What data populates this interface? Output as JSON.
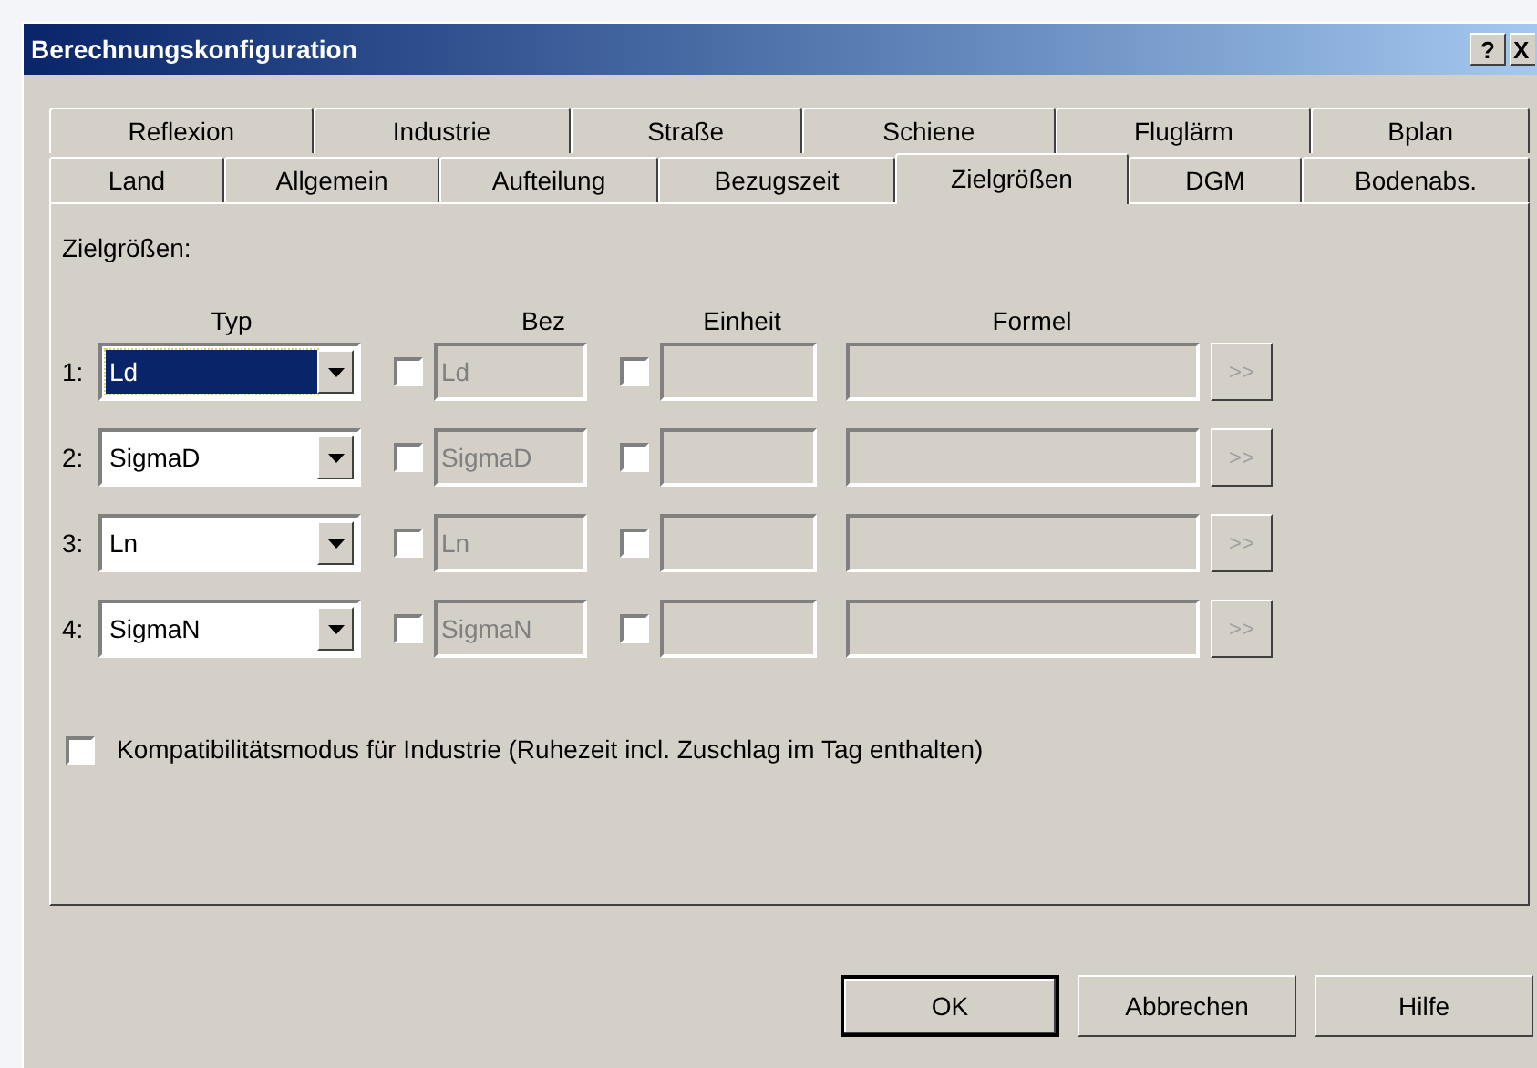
{
  "window": {
    "title": "Berechnungskonfiguration",
    "help_button": "?",
    "close_button": "X"
  },
  "tab_rows": [
    [
      {
        "label": "Reflexion",
        "selected": false
      },
      {
        "label": "Industrie",
        "selected": false
      },
      {
        "label": "Straße",
        "selected": false
      },
      {
        "label": "Schiene",
        "selected": false
      },
      {
        "label": "Fluglärm",
        "selected": false
      },
      {
        "label": "Bplan",
        "selected": false
      }
    ],
    [
      {
        "label": "Land",
        "selected": false
      },
      {
        "label": "Allgemein",
        "selected": false
      },
      {
        "label": "Aufteilung",
        "selected": false
      },
      {
        "label": "Bezugszeit",
        "selected": false
      },
      {
        "label": "Zielgrößen",
        "selected": true
      },
      {
        "label": "DGM",
        "selected": false
      },
      {
        "label": "Bodenabs.",
        "selected": false
      }
    ]
  ],
  "section_label": "Zielgrößen:",
  "columns": [
    "Typ",
    "Bez",
    "Einheit",
    "Formel"
  ],
  "rows": [
    {
      "index": "1:",
      "typ": "Ld",
      "focused": true,
      "bez_checked": false,
      "bez": "Ld",
      "einheit_checked": false,
      "formel_button": ">>"
    },
    {
      "index": "2:",
      "typ": "SigmaD",
      "focused": false,
      "bez_checked": false,
      "bez": "SigmaD",
      "einheit_checked": false,
      "formel_button": ">>"
    },
    {
      "index": "3:",
      "typ": "Ln",
      "focused": false,
      "bez_checked": false,
      "bez": "Ln",
      "einheit_checked": false,
      "formel_button": ">>"
    },
    {
      "index": "4:",
      "typ": "SigmaN",
      "focused": false,
      "bez_checked": false,
      "bez": "SigmaN",
      "einheit_checked": false,
      "formel_button": ">>"
    }
  ],
  "compat": {
    "label": "Kompatibilitätsmodus für Industrie (Ruhezeit incl. Zuschlag im Tag enthalten)",
    "checked": false
  },
  "buttons": [
    {
      "label": "OK",
      "default": true
    },
    {
      "label": "Abbrechen",
      "default": false
    },
    {
      "label": "Hilfe",
      "default": false
    }
  ]
}
